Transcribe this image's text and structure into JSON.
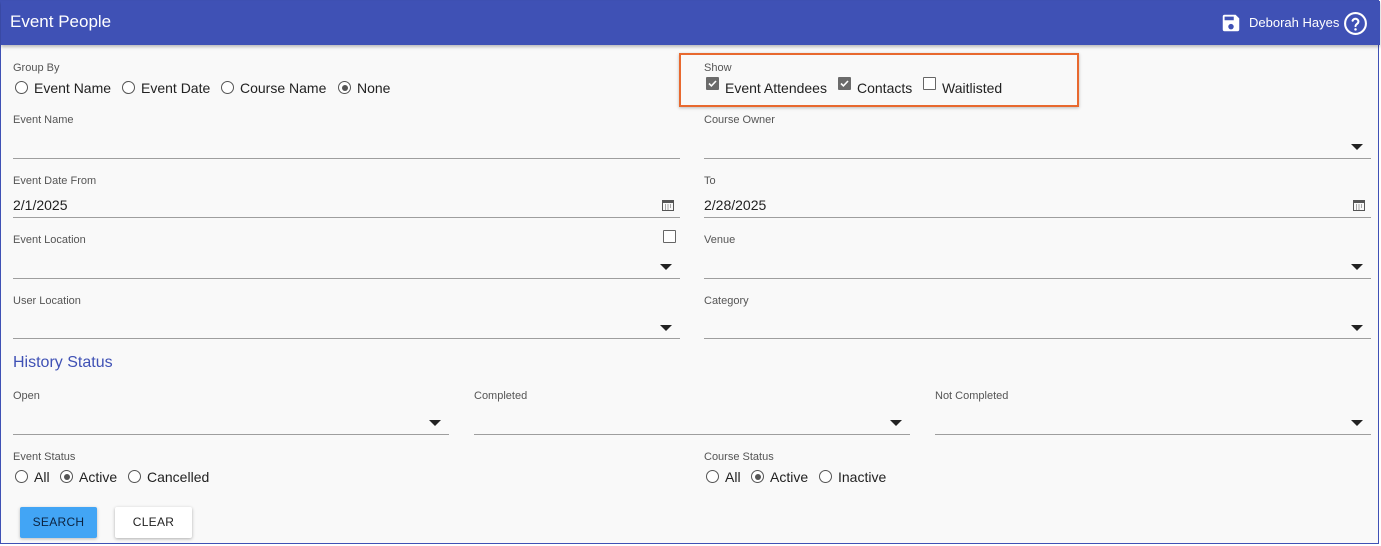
{
  "header": {
    "title": "Event People",
    "user_name": "Deborah Hayes",
    "save_icon": "save-icon",
    "help_icon": "help-icon",
    "bg_color": "#3f51b5"
  },
  "group_by": {
    "label": "Group By",
    "options": [
      "Event Name",
      "Event Date",
      "Course Name",
      "None"
    ],
    "selected": "None"
  },
  "show": {
    "label": "Show",
    "options": [
      {
        "label": "Event Attendees",
        "checked": true
      },
      {
        "label": "Contacts",
        "checked": true
      },
      {
        "label": "Waitlisted",
        "checked": false
      }
    ],
    "highlight_color": "#e8692f"
  },
  "fields": {
    "event_name": {
      "label": "Event Name",
      "value": ""
    },
    "course_owner": {
      "label": "Course Owner",
      "value": ""
    },
    "event_date_from": {
      "label": "Event Date From",
      "value": "2/1/2025"
    },
    "event_date_to": {
      "label": "To",
      "value": "2/28/2025"
    },
    "event_location": {
      "label": "Event Location",
      "value": "",
      "checkbox_checked": false
    },
    "venue": {
      "label": "Venue",
      "value": ""
    },
    "user_location": {
      "label": "User Location",
      "value": ""
    },
    "category": {
      "label": "Category",
      "value": ""
    }
  },
  "history_status": {
    "title": "History Status",
    "open": {
      "label": "Open",
      "value": ""
    },
    "completed": {
      "label": "Completed",
      "value": ""
    },
    "not_completed": {
      "label": "Not Completed",
      "value": ""
    }
  },
  "event_status": {
    "label": "Event Status",
    "options": [
      "All",
      "Active",
      "Cancelled"
    ],
    "selected": "Active"
  },
  "course_status": {
    "label": "Course Status",
    "options": [
      "All",
      "Active",
      "Inactive"
    ],
    "selected": "Active"
  },
  "buttons": {
    "search": "SEARCH",
    "clear": "CLEAR"
  }
}
